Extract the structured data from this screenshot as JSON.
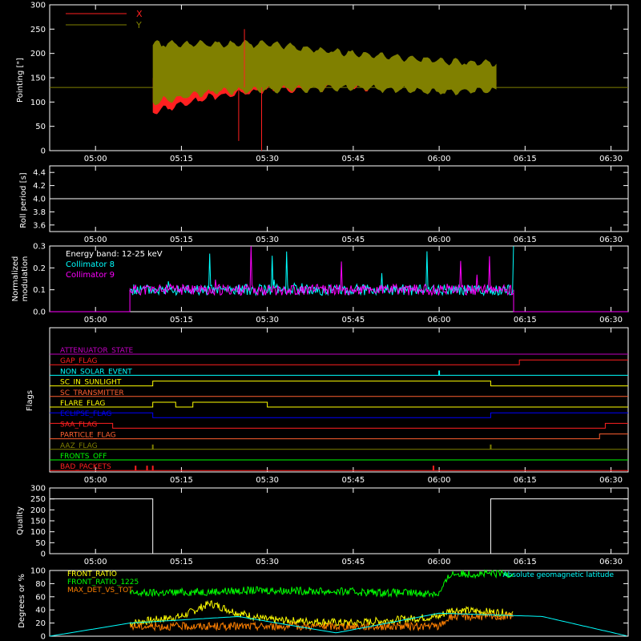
{
  "colors": {
    "frame": "#ffffff",
    "red": "#ff2020",
    "olive": "#808000",
    "cyan": "#00ffff",
    "magenta": "#ff00ff",
    "yellow": "#ffff00",
    "orange": "#ff8000",
    "green": "#00ff00",
    "blue": "#0000ff",
    "bgreen": "#00ff00",
    "white": "#ffffff",
    "purple": "#c000c0",
    "brown": "#ff6030"
  },
  "time_ticks": [
    "05:00",
    "05:15",
    "05:30",
    "05:45",
    "06:00",
    "06:15",
    "06:30"
  ],
  "chart_data": [
    {
      "type": "area",
      "ylabel": "Pointing [\"]",
      "ylim": [
        0,
        300
      ],
      "yticks": [
        "0",
        "50",
        "100",
        "150",
        "200",
        "250",
        "300"
      ],
      "legend": [
        "X",
        "Y"
      ],
      "series": [
        {
          "name": "X",
          "color": "red",
          "x": [
            "05:10",
            "05:20",
            "05:30",
            "05:45",
            "06:00",
            "06:10"
          ],
          "min": [
            80,
            110,
            125,
            130,
            130,
            130
          ],
          "max": [
            150,
            155,
            150,
            145,
            155,
            150
          ]
        },
        {
          "name": "Y",
          "color": "olive",
          "x": [
            "05:10",
            "05:20",
            "05:30",
            "05:45",
            "06:00",
            "06:10"
          ],
          "min": [
            100,
            120,
            125,
            130,
            120,
            125
          ],
          "max": [
            220,
            220,
            220,
            200,
            185,
            180
          ]
        }
      ],
      "baseline": 130,
      "spikes": [
        {
          "x": "05:29",
          "y": 0
        },
        {
          "x": "05:26",
          "y": 250
        },
        {
          "x": "05:25",
          "y": 20
        }
      ]
    },
    {
      "type": "line",
      "ylabel": "Roll period [s]",
      "ylim": [
        3.5,
        4.5
      ],
      "yticks": [
        "3.6",
        "3.8",
        "4.0",
        "4.2",
        "4.4"
      ],
      "value": 4.0
    },
    {
      "type": "line",
      "ylabel": "Normalized modulation",
      "ylabel_lines": [
        "Normalized",
        "modulation"
      ],
      "ylim": [
        0,
        0.3
      ],
      "yticks": [
        "0.0",
        "0.1",
        "0.2",
        "0.3"
      ],
      "annotation": "Energy band: 12-25 keV",
      "legend": [
        "Collimator 8",
        "Collimator 9"
      ],
      "x_start": "05:06",
      "x_end": "06:13",
      "level": 0.1
    },
    {
      "type": "line",
      "ylabel": "Flags",
      "flags": [
        {
          "name": "ATTENUATOR_STATE",
          "color": "purple",
          "steps": [
            [
              0,
              0
            ]
          ]
        },
        {
          "name": "GAP_FLAG",
          "color": "red",
          "steps": [
            [
              0,
              0
            ],
            [
              "06:14",
              1
            ]
          ]
        },
        {
          "name": "NON_SOLAR_EVENT",
          "color": "cyan",
          "steps": [
            [
              0,
              0
            ]
          ],
          "ticks": [
            "06:00"
          ]
        },
        {
          "name": "SC_IN_SUNLIGHT",
          "color": "yellow",
          "steps": [
            [
              0,
              0
            ],
            [
              "05:10",
              1
            ],
            [
              "06:09",
              0
            ]
          ]
        },
        {
          "name": "SC_TRANSMITTER",
          "color": "brown",
          "steps": [
            [
              0,
              0
            ]
          ]
        },
        {
          "name": "FLARE_FLAG",
          "color": "yellow",
          "steps": [
            [
              0,
              0
            ],
            [
              "05:10",
              1
            ],
            [
              "05:14",
              0
            ],
            [
              "05:17",
              1
            ],
            [
              "05:30",
              0
            ]
          ]
        },
        {
          "name": "ECLIPSE_FLAG",
          "color": "blue",
          "steps": [
            [
              0,
              1
            ],
            [
              "05:10",
              0
            ],
            [
              "06:09",
              1
            ]
          ]
        },
        {
          "name": "SAA_FLAG",
          "color": "red",
          "steps": [
            [
              0,
              1
            ],
            [
              "05:03",
              0
            ],
            [
              "06:29",
              1
            ]
          ]
        },
        {
          "name": "PARTICLE_FLAG",
          "color": "brown",
          "steps": [
            [
              0,
              0
            ],
            [
              "06:28",
              1
            ]
          ]
        },
        {
          "name": "AAZ_FLAG",
          "color": "olive",
          "steps": [
            [
              0,
              0
            ]
          ],
          "ticks": [
            "05:10",
            "06:09"
          ]
        },
        {
          "name": "FRONTS_OFF",
          "color": "bgreen",
          "steps": [
            [
              0,
              0
            ]
          ]
        },
        {
          "name": "BAD_PACKETS",
          "color": "red",
          "steps": [
            [
              0,
              0
            ]
          ],
          "ticks": [
            "05:07",
            "05:09",
            "05:10",
            "05:59"
          ]
        }
      ]
    },
    {
      "type": "line",
      "ylabel": "Quality",
      "ylim": [
        0,
        300
      ],
      "yticks": [
        "0",
        "50",
        "100",
        "150",
        "200",
        "250",
        "300"
      ],
      "segments": [
        {
          "from": "04:52",
          "to": "05:10",
          "value": 250
        },
        {
          "from": "05:10",
          "to": "06:09",
          "value": 0
        },
        {
          "from": "06:09",
          "to": "06:33",
          "value": 250
        }
      ]
    },
    {
      "type": "line",
      "ylabel": "Degrees or %",
      "ylim": [
        0,
        100
      ],
      "yticks": [
        "0",
        "20",
        "40",
        "60",
        "80",
        "100"
      ],
      "legend": [
        "FRONT_RATIO",
        "FRONT_RATIO_1225",
        "MAX_DET_VS_TOT"
      ],
      "legend_right": "Absolute geomagnetic latitude",
      "series": [
        {
          "name": "FRONT_RATIO",
          "color": "yellow",
          "x": [
            "05:06",
            "05:15",
            "05:20",
            "05:25",
            "05:30",
            "05:45",
            "06:00",
            "06:02",
            "06:13"
          ],
          "values": [
            20,
            30,
            50,
            35,
            25,
            20,
            30,
            40,
            35
          ]
        },
        {
          "name": "FRONT_RATIO_1225",
          "color": "bgreen",
          "x": [
            "05:06",
            "05:30",
            "06:00",
            "06:02",
            "06:13"
          ],
          "values": [
            65,
            70,
            65,
            95,
            95
          ]
        },
        {
          "name": "MAX_DET_VS_TOT",
          "color": "orange",
          "x": [
            "05:06",
            "05:30",
            "06:00",
            "06:02",
            "06:13"
          ],
          "values": [
            15,
            15,
            15,
            30,
            30
          ]
        },
        {
          "name": "Absolute geomagnetic latitude",
          "color": "cyan",
          "x": [
            "04:52",
            "05:06",
            "05:25",
            "05:42",
            "06:00",
            "06:18",
            "06:33"
          ],
          "values": [
            0,
            20,
            30,
            5,
            35,
            30,
            0
          ]
        }
      ]
    }
  ]
}
